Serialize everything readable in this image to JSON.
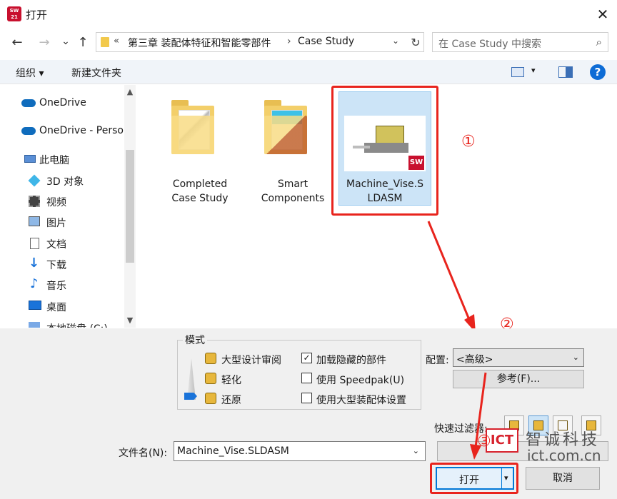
{
  "window": {
    "title": "打开",
    "logo_text": "SW 2021",
    "close": "✕"
  },
  "nav": {
    "back": "←",
    "forward": "→",
    "recent": "⌄",
    "up": "↑"
  },
  "address": {
    "ellipsis": "«",
    "crumb1": "第三章 装配体特征和智能零部件",
    "separator": "›",
    "crumb2": "Case Study",
    "dropdown": "⌄",
    "refresh": "↻"
  },
  "search": {
    "placeholder": "在 Case Study 中搜索",
    "icon": "⌕"
  },
  "toolbar": {
    "organize": "组织 ▾",
    "new_folder": "新建文件夹",
    "help": "?",
    "view_dd": "▾"
  },
  "sidebar": {
    "items": [
      {
        "label": "OneDrive",
        "icon": "cloud-icon"
      },
      {
        "label": "OneDrive - Perso",
        "icon": "cloud-icon"
      },
      {
        "label": "此电脑",
        "icon": "computer-icon"
      },
      {
        "label": "3D 对象",
        "icon": "cube-icon"
      },
      {
        "label": "视频",
        "icon": "video-icon"
      },
      {
        "label": "图片",
        "icon": "image-icon"
      },
      {
        "label": "文档",
        "icon": "document-icon"
      },
      {
        "label": "下载",
        "icon": "download-icon"
      },
      {
        "label": "音乐",
        "icon": "music-icon"
      },
      {
        "label": "桌面",
        "icon": "desktop-icon"
      },
      {
        "label": "本地磁盘 (C:)",
        "icon": "drive-icon"
      }
    ],
    "scroll_up": "▲",
    "scroll_down": "▼"
  },
  "files": [
    {
      "label_line1": "Completed",
      "label_line2": "Case Study",
      "type": "folder"
    },
    {
      "label_line1": "Smart",
      "label_line2": "Components",
      "type": "folder"
    },
    {
      "label_line1": "Machine_Vise.S",
      "label_line2": "LDASM",
      "type": "assembly"
    }
  ],
  "annotations": {
    "one": "①",
    "two": "②",
    "three": "③"
  },
  "mode": {
    "title": "模式",
    "options": [
      "大型设计审阅",
      "轻化",
      "还原"
    ],
    "checks": [
      {
        "label": "加载隐藏的部件",
        "checked": "✓"
      },
      {
        "label": "使用 Speedpak(U)",
        "checked": ""
      },
      {
        "label": "使用大型装配体设置",
        "checked": ""
      }
    ]
  },
  "config": {
    "label": "配置:",
    "value": "<高级>",
    "dropdown": "⌄",
    "ref_button": "参考(F)..."
  },
  "quick_filter": {
    "label": "快速过滤器:"
  },
  "filename": {
    "label": "文件名(N):",
    "value": "Machine_Vise.SLDASM",
    "dropdown": "⌄"
  },
  "buttons": {
    "open": "打开",
    "open_dd": "▾",
    "cancel": "取消"
  },
  "watermark": {
    "logo": "ICT",
    "cn": "智诚科技",
    "url": "ict.com.cn"
  },
  "colors": {
    "accent": "#0078d7",
    "annotation_red": "#e8241d"
  }
}
